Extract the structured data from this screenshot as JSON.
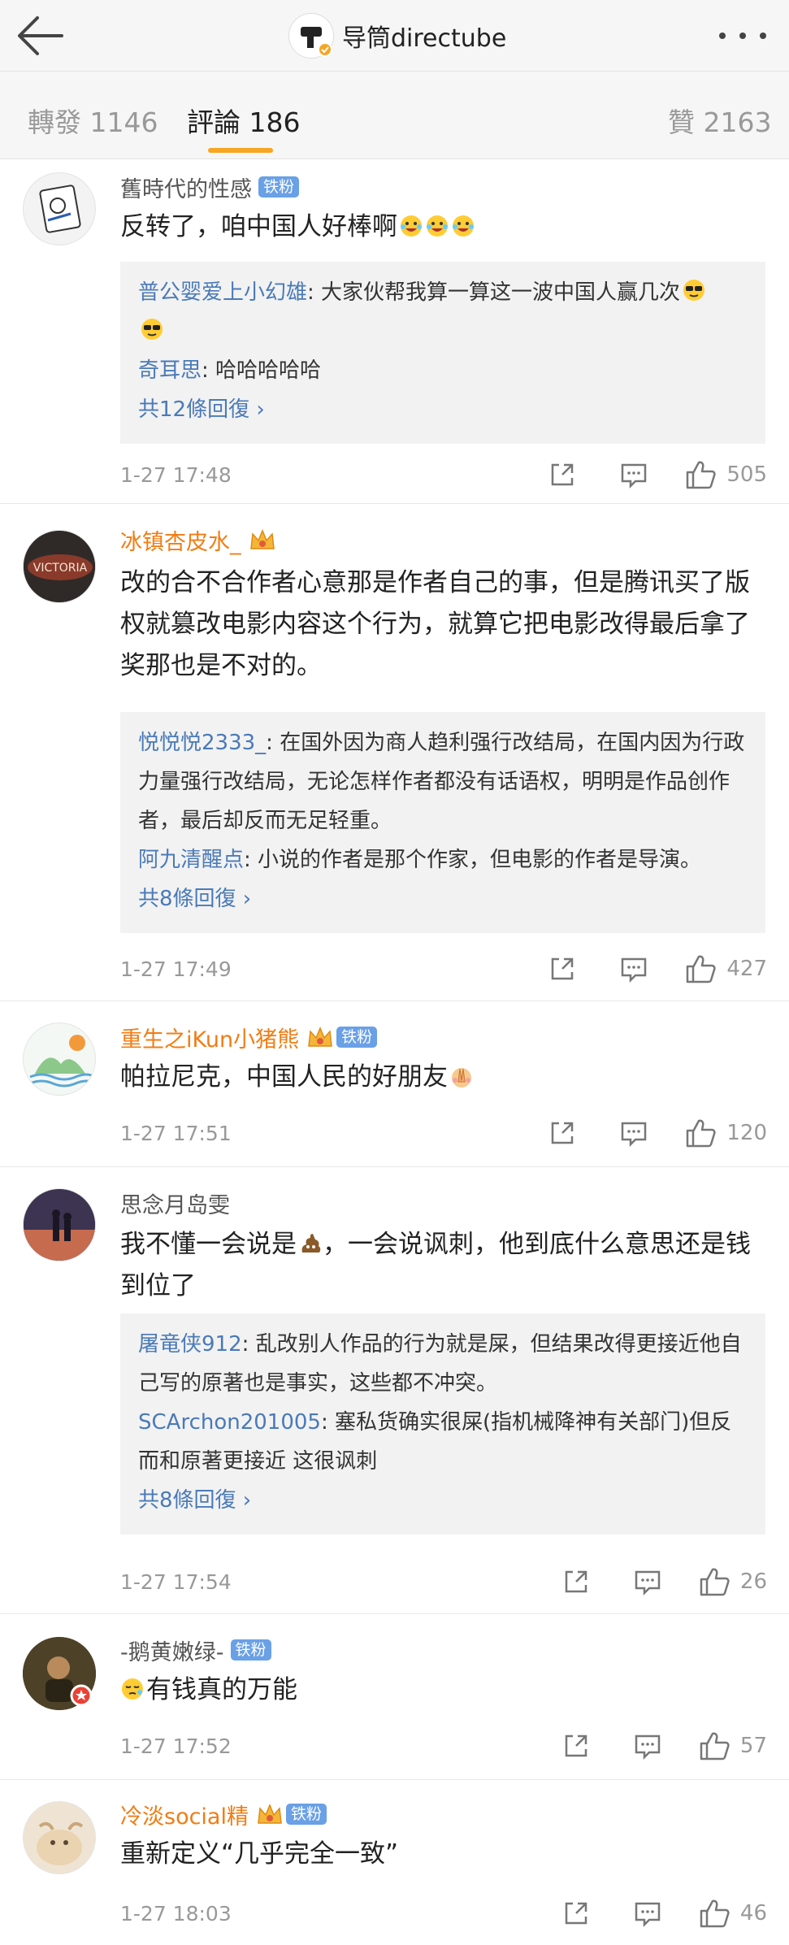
{
  "header": {
    "title": "导筒directube",
    "back_icon": "back-arrow-icon",
    "more_icon": "more-dots-icon"
  },
  "tabs": [
    {
      "label": "轉發 1146"
    },
    {
      "label": "評論 186"
    },
    {
      "label": "贊 2163"
    }
  ],
  "colors": {
    "accent": "#f6a623",
    "link": "#4a7ab8",
    "vip_name": "#f07d14",
    "badge": "#6aa0e6"
  },
  "comments": [
    {
      "user": "舊時代的性感",
      "badge": "铁粉",
      "text": "反转了，咱中国人好棒啊",
      "replies": [
        {
          "name": "普公婴爱上小幻雄",
          "text": ": 大家伙帮我算一算这一波中国人赢几次"
        },
        {
          "name": "奇耳思",
          "text": ": 哈哈哈哈哈"
        }
      ],
      "more": "共12條回復 ›",
      "time": "1-27 17:48",
      "likes": "505"
    },
    {
      "user": "冰镇杏皮水_",
      "text": "改的合不合作者心意那是作者自己的事，但是腾讯买了版权就篡改电影内容这个行为，就算它把电影改得最后拿了奖那也是不对的。",
      "replies": [
        {
          "name": "悦悦悦2333_",
          "text": ": 在国外因为商人趋利强行改结局，在国内因为行政力量强行改结局，无论怎样作者都没有话语权，明明是作品创作者，最后却反而无足轻重。"
        },
        {
          "name": "阿九清醒点",
          "text": ": 小说的作者是那个作家，但电影的作者是导演。"
        }
      ],
      "more": "共8條回復 ›",
      "time": "1-27 17:49",
      "likes": "427"
    },
    {
      "user": "重生之iKun小猪熊",
      "badge": "铁粉",
      "text": "帕拉尼克，中国人民的好朋友",
      "time": "1-27 17:51",
      "likes": "120"
    },
    {
      "user": "思念月岛雯",
      "text": "我不懂一会说是",
      "text2": "，一会说讽刺，他到底什么意思还是钱到位了",
      "replies": [
        {
          "name": "屠竜侠912",
          "text": ": 乱改别人作品的行为就是屎，但结果改得更接近他自己写的原著也是事实，这些都不冲突。"
        },
        {
          "name": "SCArchon201005",
          "text": ": 塞私货确实很屎(指机械降神有关部门)但反而和原著更接近 这很讽刺"
        }
      ],
      "more": "共8條回復 ›",
      "time": "1-27 17:54",
      "likes": "26"
    },
    {
      "user": "-鹅黄嫩绿-",
      "badge": "铁粉",
      "text": "有钱真的万能",
      "time": "1-27 17:52",
      "likes": "57"
    },
    {
      "user": "冷淡social精",
      "badge": "铁粉",
      "text": "重新定义“几乎完全一致”",
      "time": "1-27 18:03",
      "likes": "46"
    }
  ]
}
